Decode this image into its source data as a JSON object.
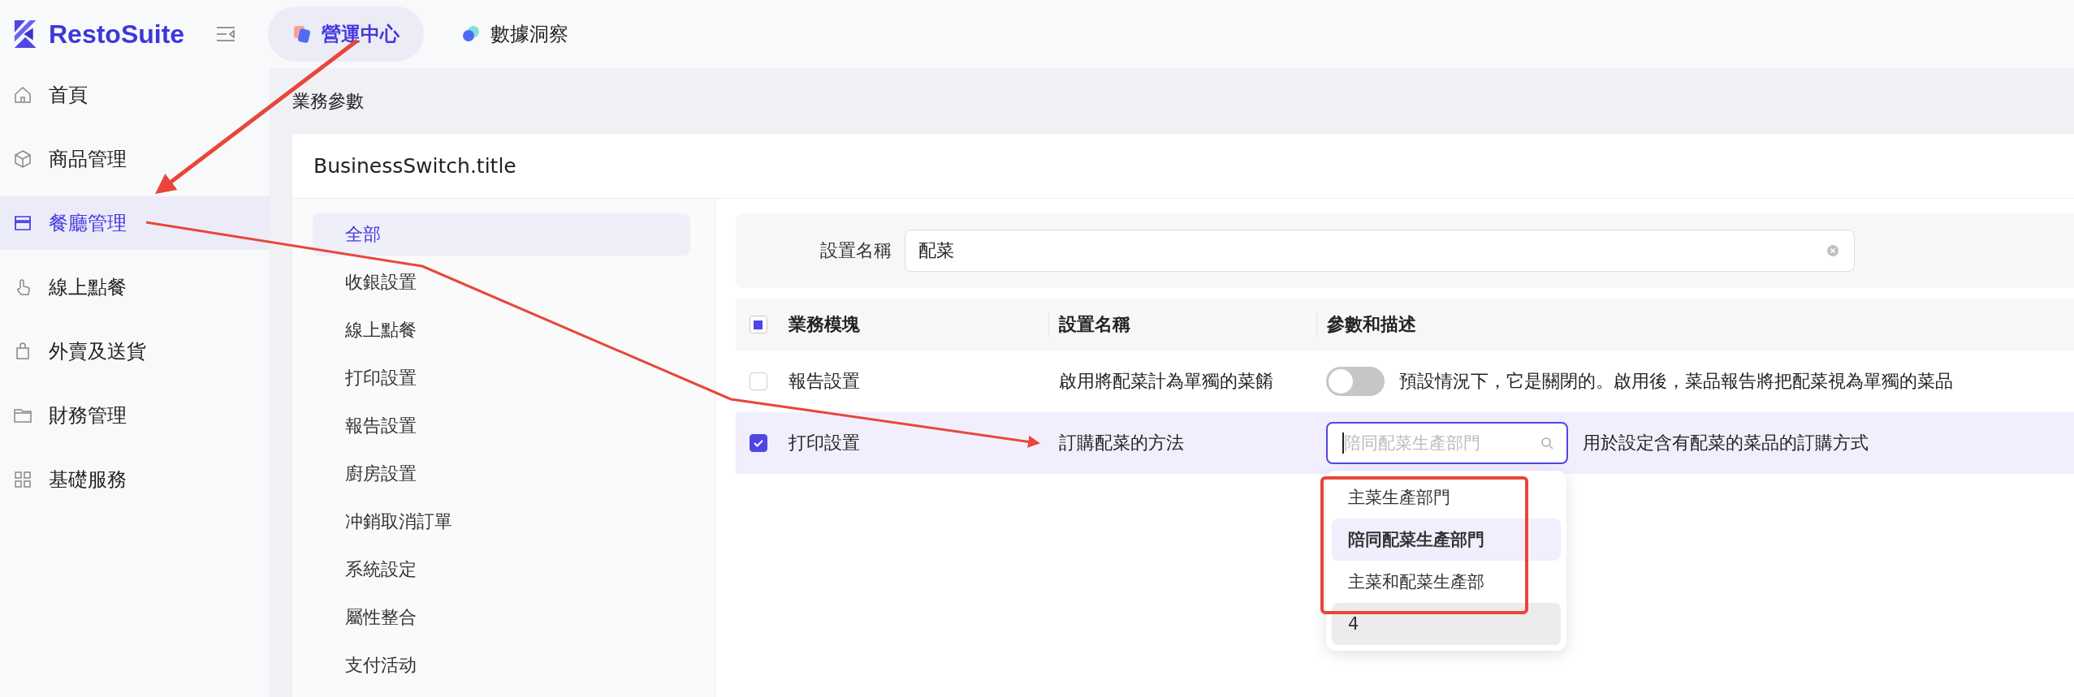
{
  "brand": {
    "name": "RestoSuite"
  },
  "top_tabs": [
    {
      "label": "營運中心",
      "selected": true
    },
    {
      "label": "數據洞察",
      "selected": false
    }
  ],
  "sidebar": {
    "items": [
      {
        "label": "首頁",
        "selected": false
      },
      {
        "label": "商品管理",
        "selected": false
      },
      {
        "label": "餐廳管理",
        "selected": true
      },
      {
        "label": "線上點餐",
        "selected": false
      },
      {
        "label": "外賣及送貨",
        "selected": false
      },
      {
        "label": "財務管理",
        "selected": false
      },
      {
        "label": "基礎服務",
        "selected": false
      }
    ]
  },
  "breadcrumb": "業務參數",
  "card": {
    "title": "BusinessSwitch.title",
    "categories": [
      {
        "label": "全部",
        "selected": true
      },
      {
        "label": "收銀設置",
        "selected": false
      },
      {
        "label": "線上點餐",
        "selected": false
      },
      {
        "label": "打印設置",
        "selected": false
      },
      {
        "label": "報告設置",
        "selected": false
      },
      {
        "label": "廚房設置",
        "selected": false
      },
      {
        "label": "冲銷取消訂單",
        "selected": false
      },
      {
        "label": "系統設定",
        "selected": false
      },
      {
        "label": "屬性整合",
        "selected": false
      },
      {
        "label": "支付活动",
        "selected": false
      }
    ],
    "filter": {
      "label": "設置名稱",
      "value": "配菜"
    },
    "table": {
      "header_checkbox": {
        "indeterminate": true
      },
      "columns": [
        "業務模塊",
        "設置名稱",
        "參數和描述"
      ],
      "rows": [
        {
          "checked": false,
          "module": "報告設置",
          "setting": "啟用將配菜計為單獨的菜餚",
          "kind": "toggle",
          "on": false,
          "description": "預設情況下，它是關閉的。啟用後，菜品報告將把配菜視為單獨的菜品"
        },
        {
          "checked": true,
          "module": "打印設置",
          "setting": "訂購配菜的方法",
          "kind": "select",
          "placeholder": "陪同配菜生產部門",
          "open": true,
          "description": "用於設定含有配菜的菜品的訂購方式",
          "options": [
            {
              "label": "主菜生產部門",
              "selected": false,
              "hovered": false
            },
            {
              "label": "陪同配菜生產部門",
              "selected": true,
              "hovered": false
            },
            {
              "label": "主菜和配菜生產部",
              "selected": false,
              "hovered": false
            },
            {
              "label": "4",
              "selected": false,
              "hovered": true
            }
          ]
        }
      ]
    }
  }
}
